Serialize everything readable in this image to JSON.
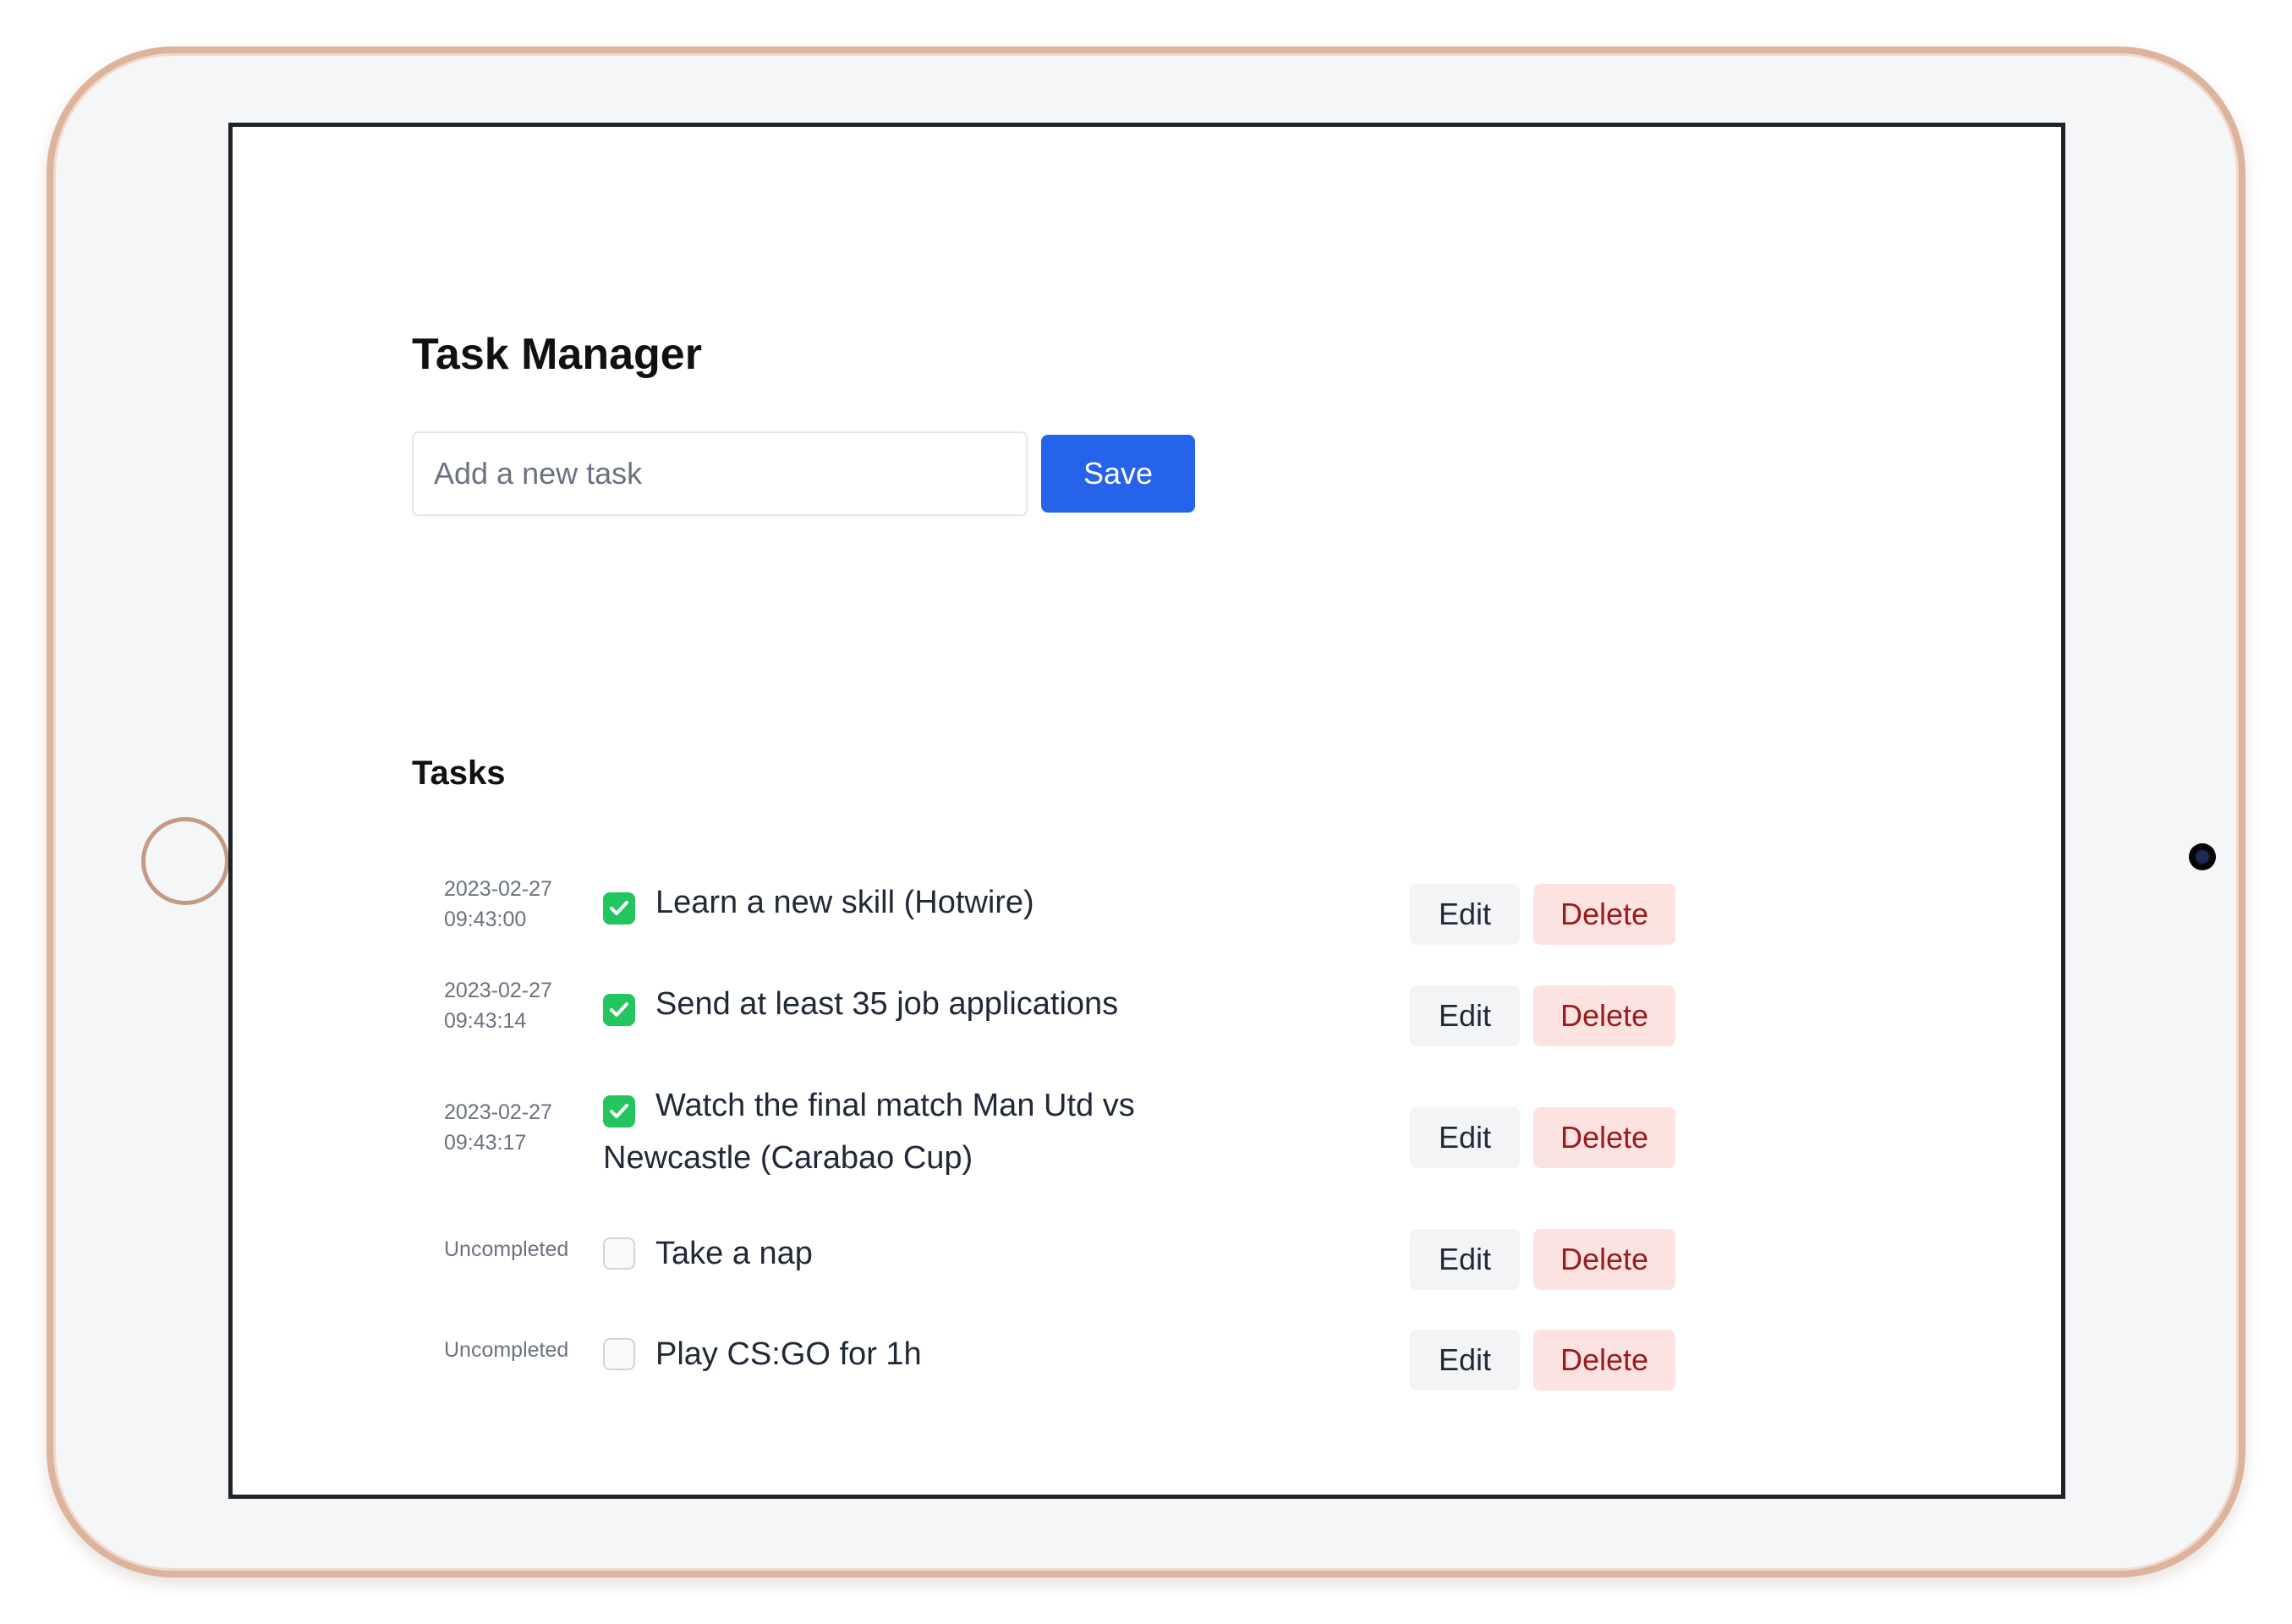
{
  "app": {
    "title": "Task Manager",
    "input": {
      "placeholder": "Add a new task",
      "value": ""
    },
    "save_label": "Save",
    "tasks_heading": "Tasks"
  },
  "tasks": [
    {
      "status": "2023-02-27\n09:43:00",
      "completed": true,
      "text": "Learn a new skill (Hotwire)",
      "edit_label": "Edit",
      "delete_label": "Delete"
    },
    {
      "status": "2023-02-27\n09:43:14",
      "completed": true,
      "text": "Send at least 35 job applications",
      "edit_label": "Edit",
      "delete_label": "Delete"
    },
    {
      "status": "2023-02-27\n09:43:17",
      "completed": true,
      "text": "Watch the final match Man Utd vs Newcastle (Carabao Cup)",
      "edit_label": "Edit",
      "delete_label": "Delete"
    },
    {
      "status": "Uncompleted",
      "completed": false,
      "text": "Take a nap",
      "edit_label": "Edit",
      "delete_label": "Delete"
    },
    {
      "status": "Uncompleted",
      "completed": false,
      "text": "Play CS:GO for 1h",
      "edit_label": "Edit",
      "delete_label": "Delete"
    }
  ],
  "colors": {
    "accent": "#2563eb",
    "completed_check": "#22c55e",
    "delete_button_bg": "#fde2e2",
    "device_frame": "#ddb39c"
  },
  "icons": {
    "checked": "check-icon"
  }
}
